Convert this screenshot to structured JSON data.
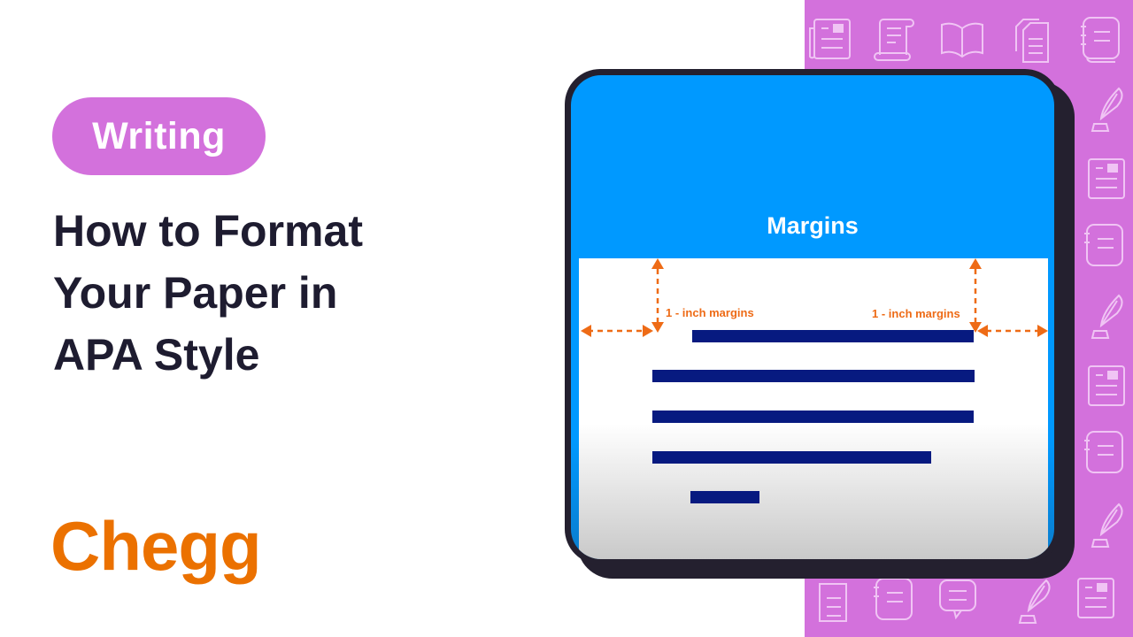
{
  "tag": {
    "label": "Writing"
  },
  "title": {
    "lines": [
      "How to Format",
      "Your Paper in",
      "APA Style"
    ]
  },
  "logo": {
    "text": "Chegg"
  },
  "card": {
    "heading": "Margins",
    "left_margin_label": "1 - inch margins",
    "right_margin_label": "1 - inch margins"
  },
  "colors": {
    "accent_pink": "#d371dc",
    "card_blue": "#0099ff",
    "text_line_navy": "#071a80",
    "arrow_orange": "#ee6b16",
    "brand_orange": "#eb7100",
    "title_dark": "#1e1c30"
  },
  "pattern_icons": [
    "newspaper-icon",
    "scroll-icon",
    "open-book-icon",
    "documents-icon",
    "notebook-icon",
    "quill-ink-icon",
    "newspaper-icon",
    "notebook-icon",
    "quill-ink-icon",
    "newspaper-icon",
    "notebook-icon",
    "quill-ink-icon",
    "document-icon",
    "notebook-icon",
    "speech-notes-icon",
    "quill-ink-icon",
    "newspaper-icon"
  ]
}
